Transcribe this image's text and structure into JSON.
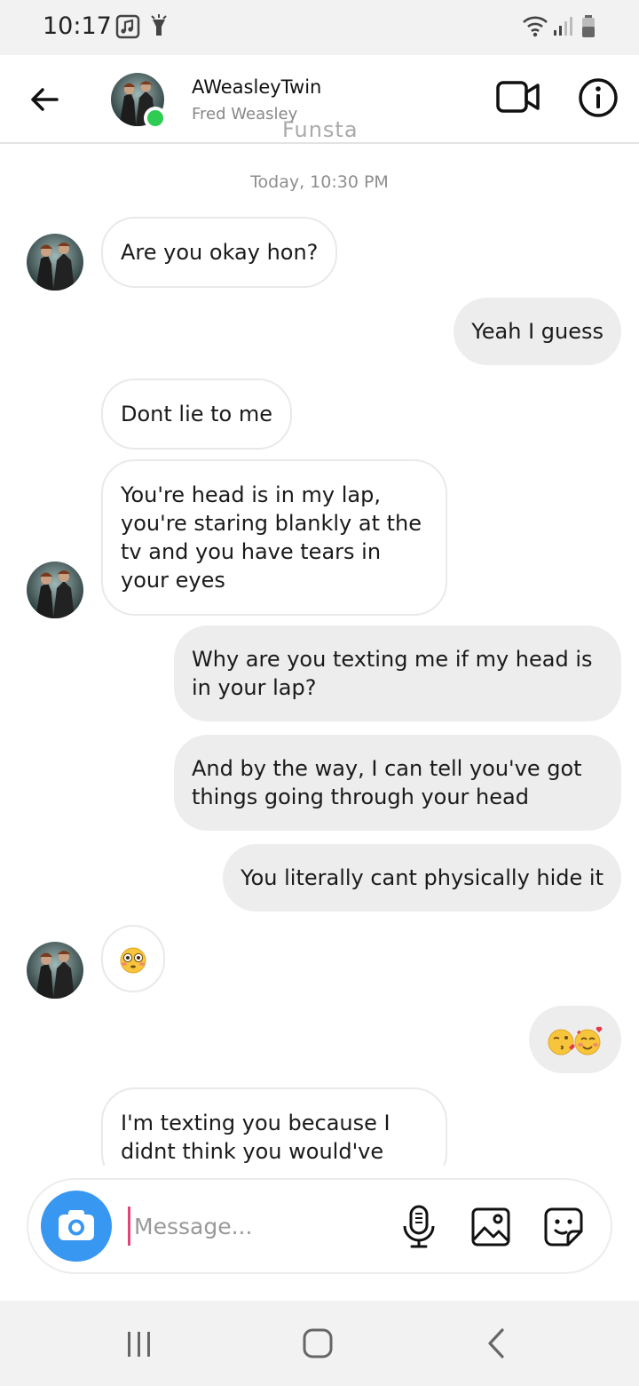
{
  "status_bar": {
    "time": "10:17"
  },
  "header": {
    "username": "AWeasleyTwin",
    "display_name": "Fred Weasley",
    "watermark": "Funsta"
  },
  "chat": {
    "timestamp": "Today, 10:30 PM",
    "messages": [
      {
        "from": "them",
        "text": "Are you okay hon?"
      },
      {
        "from": "me",
        "text": "Yeah I guess"
      },
      {
        "from": "them",
        "text": "Dont lie to me"
      },
      {
        "from": "them",
        "text": "You're head is in my lap, you're staring blankly at the tv and you have tears in your eyes"
      },
      {
        "from": "me",
        "text": "Why are you texting me if my head is in your lap?"
      },
      {
        "from": "me",
        "text": "And by the way, I can tell you've got things going through your head"
      },
      {
        "from": "me",
        "text": "You literally cant physically hide it"
      },
      {
        "from": "them",
        "text": "😳"
      },
      {
        "from": "me",
        "text": "😘🥰"
      },
      {
        "from": "them",
        "text": "I'm texting you because I didnt think you would've"
      }
    ]
  },
  "composer": {
    "placeholder": "Message..."
  },
  "colors": {
    "accent": "#3897f0",
    "online": "#2ecc52",
    "sent_bubble": "#ededed"
  }
}
